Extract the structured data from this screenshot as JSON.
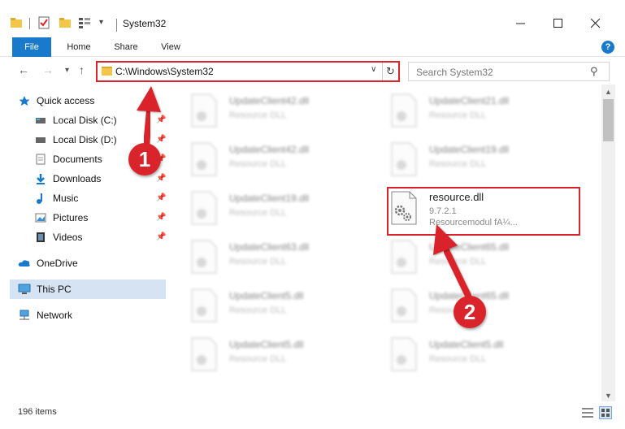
{
  "window": {
    "title": "System32",
    "controls": [
      "minimize-icon",
      "maximize-icon",
      "close-icon"
    ]
  },
  "ribbon": {
    "tabs": [
      {
        "label": "File"
      },
      {
        "label": "Home"
      },
      {
        "label": "Share"
      },
      {
        "label": "View"
      }
    ],
    "help": "?"
  },
  "nav": {
    "address": "C:\\Windows\\System32",
    "search_placeholder": "Search System32"
  },
  "sidebar": {
    "items": [
      {
        "label": "Quick access",
        "icon": "star-icon"
      },
      {
        "label": "Local Disk (C:)",
        "icon": "drive-icon",
        "pinned": true
      },
      {
        "label": "Local Disk (D:)",
        "icon": "drive-icon",
        "pinned": true
      },
      {
        "label": "Documents",
        "icon": "documents-icon",
        "pinned": true
      },
      {
        "label": "Downloads",
        "icon": "downloads-icon",
        "pinned": true
      },
      {
        "label": "Music",
        "icon": "music-icon",
        "pinned": true
      },
      {
        "label": "Pictures",
        "icon": "pictures-icon",
        "pinned": true
      },
      {
        "label": "Videos",
        "icon": "videos-icon",
        "pinned": true
      },
      {
        "label": "OneDrive",
        "icon": "cloud-icon"
      },
      {
        "label": "This PC",
        "icon": "computer-icon",
        "selected": true
      },
      {
        "label": "Network",
        "icon": "network-icon"
      }
    ]
  },
  "files": {
    "left": [
      {
        "name": "UpdateClient42.dll",
        "type": "Resource DLL"
      },
      {
        "name": "UpdateClient42.dll",
        "type": "Resource DLL"
      },
      {
        "name": "UpdateClient19.dll",
        "type": "Resource DLL"
      },
      {
        "name": "UpdateClient63.dll",
        "type": "Resource DLL"
      },
      {
        "name": "UpdateClient5.dll",
        "type": "Resource DLL"
      },
      {
        "name": "UpdateClient5.dll",
        "type": "Resource DLL"
      }
    ],
    "right": [
      {
        "name": "UpdateClient21.dll",
        "type": "Resource DLL"
      },
      {
        "name": "UpdateClient19.dll",
        "type": "Resource DLL"
      },
      {
        "name": "resource.dll",
        "version": "9.7.2.1",
        "desc": "Resourcemodul fA¼...",
        "highlighted": true
      },
      {
        "name": "UpdateClient65.dll",
        "type": "Resource DLL"
      },
      {
        "name": "UpdateClient65.dll",
        "type": "Resource DLL"
      },
      {
        "name": "UpdateClient5.dll",
        "type": "Resource DLL"
      }
    ]
  },
  "status": {
    "count": "196 items"
  },
  "annotations": {
    "step1": "1",
    "step2": "2",
    "color": "#d9242b"
  },
  "colors": {
    "accent": "#1979ca",
    "selection": "#d5e3f2",
    "annotation": "#d9242b"
  }
}
